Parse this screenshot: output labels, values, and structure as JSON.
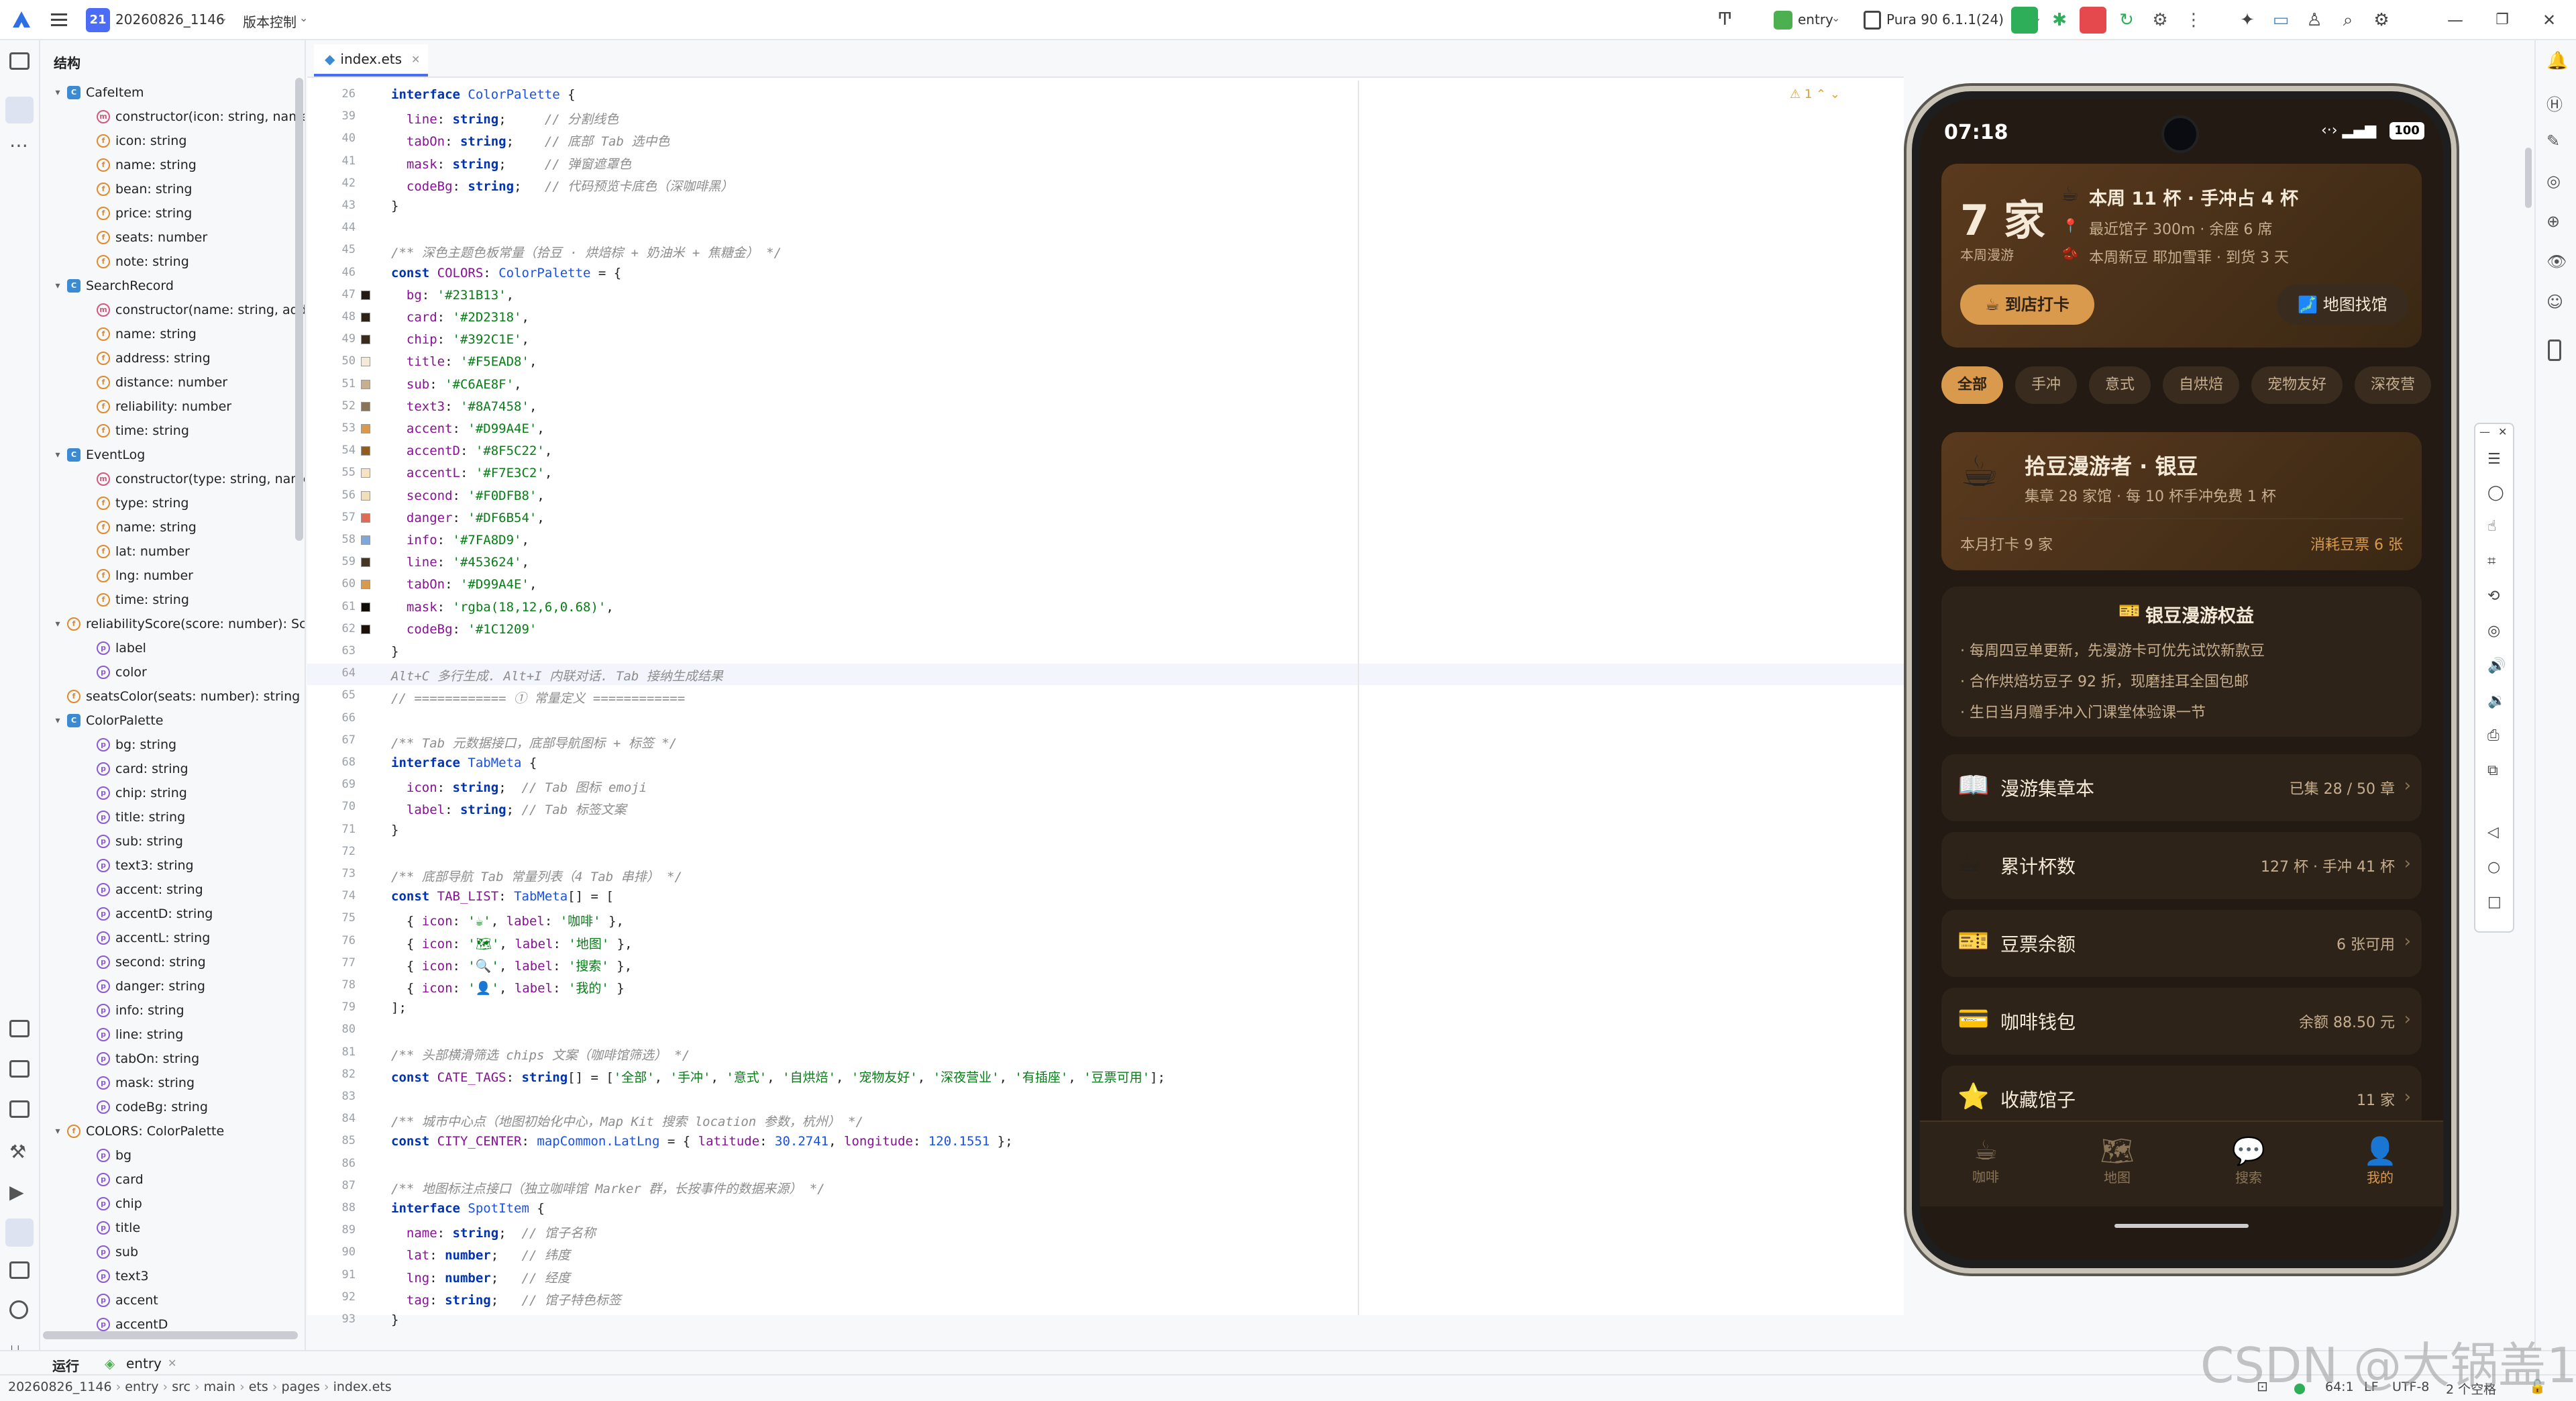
{
  "titlebar": {
    "project_badge": "21",
    "project": "20260826_1146",
    "vcs": "版本控制",
    "module": "entry",
    "device": "Pura 90 6.1.1(24)"
  },
  "structure": {
    "title": "结构",
    "items": [
      {
        "indent": 0,
        "icon": "c",
        "arrow": "▾",
        "text": "CafeItem"
      },
      {
        "indent": 1,
        "icon": "m",
        "arrow": "",
        "text": "constructor(icon: string, name:"
      },
      {
        "indent": 1,
        "icon": "f",
        "arrow": "",
        "text": "icon: string"
      },
      {
        "indent": 1,
        "icon": "f",
        "arrow": "",
        "text": "name: string"
      },
      {
        "indent": 1,
        "icon": "f",
        "arrow": "",
        "text": "bean: string"
      },
      {
        "indent": 1,
        "icon": "f",
        "arrow": "",
        "text": "price: string"
      },
      {
        "indent": 1,
        "icon": "f",
        "arrow": "",
        "text": "seats: number"
      },
      {
        "indent": 1,
        "icon": "f",
        "arrow": "",
        "text": "note: string"
      },
      {
        "indent": 0,
        "icon": "c",
        "arrow": "▾",
        "text": "SearchRecord"
      },
      {
        "indent": 1,
        "icon": "m",
        "arrow": "",
        "text": "constructor(name: string, addre"
      },
      {
        "indent": 1,
        "icon": "f",
        "arrow": "",
        "text": "name: string"
      },
      {
        "indent": 1,
        "icon": "f",
        "arrow": "",
        "text": "address: string"
      },
      {
        "indent": 1,
        "icon": "f",
        "arrow": "",
        "text": "distance: number"
      },
      {
        "indent": 1,
        "icon": "f",
        "arrow": "",
        "text": "reliability: number"
      },
      {
        "indent": 1,
        "icon": "f",
        "arrow": "",
        "text": "time: string"
      },
      {
        "indent": 0,
        "icon": "c",
        "arrow": "▾",
        "text": "EventLog"
      },
      {
        "indent": 1,
        "icon": "m",
        "arrow": "",
        "text": "constructor(type: string, name:"
      },
      {
        "indent": 1,
        "icon": "f",
        "arrow": "",
        "text": "type: string"
      },
      {
        "indent": 1,
        "icon": "f",
        "arrow": "",
        "text": "name: string"
      },
      {
        "indent": 1,
        "icon": "f",
        "arrow": "",
        "text": "lat: number"
      },
      {
        "indent": 1,
        "icon": "f",
        "arrow": "",
        "text": "lng: number"
      },
      {
        "indent": 1,
        "icon": "f",
        "arrow": "",
        "text": "time: string"
      },
      {
        "indent": 0,
        "icon": "f",
        "arrow": "▾",
        "text": "reliabilityScore(score: number): Sc"
      },
      {
        "indent": 1,
        "icon": "p",
        "arrow": "",
        "text": "label"
      },
      {
        "indent": 1,
        "icon": "p",
        "arrow": "",
        "text": "color"
      },
      {
        "indent": 0,
        "icon": "f",
        "arrow": "",
        "text": "seatsColor(seats: number): string"
      },
      {
        "indent": 0,
        "icon": "c",
        "arrow": "▾",
        "text": "ColorPalette"
      },
      {
        "indent": 1,
        "icon": "p",
        "arrow": "",
        "text": "bg: string"
      },
      {
        "indent": 1,
        "icon": "p",
        "arrow": "",
        "text": "card: string"
      },
      {
        "indent": 1,
        "icon": "p",
        "arrow": "",
        "text": "chip: string"
      },
      {
        "indent": 1,
        "icon": "p",
        "arrow": "",
        "text": "title: string"
      },
      {
        "indent": 1,
        "icon": "p",
        "arrow": "",
        "text": "sub: string"
      },
      {
        "indent": 1,
        "icon": "p",
        "arrow": "",
        "text": "text3: string"
      },
      {
        "indent": 1,
        "icon": "p",
        "arrow": "",
        "text": "accent: string"
      },
      {
        "indent": 1,
        "icon": "p",
        "arrow": "",
        "text": "accentD: string"
      },
      {
        "indent": 1,
        "icon": "p",
        "arrow": "",
        "text": "accentL: string"
      },
      {
        "indent": 1,
        "icon": "p",
        "arrow": "",
        "text": "second: string"
      },
      {
        "indent": 1,
        "icon": "p",
        "arrow": "",
        "text": "danger: string"
      },
      {
        "indent": 1,
        "icon": "p",
        "arrow": "",
        "text": "info: string"
      },
      {
        "indent": 1,
        "icon": "p",
        "arrow": "",
        "text": "line: string"
      },
      {
        "indent": 1,
        "icon": "p",
        "arrow": "",
        "text": "tabOn: string"
      },
      {
        "indent": 1,
        "icon": "p",
        "arrow": "",
        "text": "mask: string"
      },
      {
        "indent": 1,
        "icon": "p",
        "arrow": "",
        "text": "codeBg: string"
      },
      {
        "indent": 0,
        "icon": "f",
        "arrow": "▾",
        "text": "COLORS: ColorPalette"
      },
      {
        "indent": 1,
        "icon": "p",
        "arrow": "",
        "text": "bg"
      },
      {
        "indent": 1,
        "icon": "p",
        "arrow": "",
        "text": "card"
      },
      {
        "indent": 1,
        "icon": "p",
        "arrow": "",
        "text": "chip"
      },
      {
        "indent": 1,
        "icon": "p",
        "arrow": "",
        "text": "title"
      },
      {
        "indent": 1,
        "icon": "p",
        "arrow": "",
        "text": "sub"
      },
      {
        "indent": 1,
        "icon": "p",
        "arrow": "",
        "text": "text3"
      },
      {
        "indent": 1,
        "icon": "p",
        "arrow": "",
        "text": "accent"
      },
      {
        "indent": 1,
        "icon": "p",
        "arrow": "",
        "text": "accentD"
      }
    ]
  },
  "editor": {
    "tab": "index.ets",
    "warnings": "1",
    "lines": [
      {
        "n": "26",
        "html": "<span class='kw'>interface</span> <span class='ty'>ColorPalette</span> {"
      },
      {
        "n": "39",
        "html": "  <span class='pr'>line</span>: <span class='kw'>string</span>;     <span class='cm'>// 分割线色</span>"
      },
      {
        "n": "40",
        "html": "  <span class='pr'>tabOn</span>: <span class='kw'>string</span>;    <span class='cm'>// 底部 Tab 选中色</span>"
      },
      {
        "n": "41",
        "html": "  <span class='pr'>mask</span>: <span class='kw'>string</span>;     <span class='cm'>// 弹窗遮罩色</span>"
      },
      {
        "n": "42",
        "html": "  <span class='pr'>codeBg</span>: <span class='kw'>string</span>;   <span class='cm'>// 代码预览卡底色（深咖啡黑）</span>"
      },
      {
        "n": "43",
        "html": "}"
      },
      {
        "n": "44",
        "html": ""
      },
      {
        "n": "45",
        "html": "<span class='cm'>/** 深色主题色板常量（拾豆 · 烘焙棕 + 奶油米 + 焦糖金） */</span>"
      },
      {
        "n": "46",
        "html": "<span class='kw'>const</span> <span class='pr'>COLORS</span>: <span class='ty'>ColorPalette</span> = {"
      },
      {
        "n": "47",
        "sw": "#231B13",
        "html": "  <span class='pr'>bg</span>: <span class='str'>'#231B13'</span>,"
      },
      {
        "n": "48",
        "sw": "#2D2318",
        "html": "  <span class='pr'>card</span>: <span class='str'>'#2D2318'</span>,"
      },
      {
        "n": "49",
        "sw": "#392C1E",
        "html": "  <span class='pr'>chip</span>: <span class='str'>'#392C1E'</span>,"
      },
      {
        "n": "50",
        "sw": "#F5EAD8",
        "html": "  <span class='pr'>title</span>: <span class='str'>'#F5EAD8'</span>,"
      },
      {
        "n": "51",
        "sw": "#C6AE8F",
        "html": "  <span class='pr'>sub</span>: <span class='str'>'#C6AE8F'</span>,"
      },
      {
        "n": "52",
        "sw": "#8A7458",
        "html": "  <span class='pr'>text3</span>: <span class='str'>'#8A7458'</span>,"
      },
      {
        "n": "53",
        "sw": "#D99A4E",
        "html": "  <span class='pr'>accent</span>: <span class='str'>'#D99A4E'</span>,"
      },
      {
        "n": "54",
        "sw": "#8F5C22",
        "html": "  <span class='pr'>accentD</span>: <span class='str'>'#8F5C22'</span>,"
      },
      {
        "n": "55",
        "sw": "#F7E3C2",
        "html": "  <span class='pr'>accentL</span>: <span class='str'>'#F7E3C2'</span>,"
      },
      {
        "n": "56",
        "sw": "#F0DFB8",
        "html": "  <span class='pr'>second</span>: <span class='str'>'#F0DFB8'</span>,"
      },
      {
        "n": "57",
        "sw": "#DF6B54",
        "html": "  <span class='pr'>danger</span>: <span class='str'>'#DF6B54'</span>,"
      },
      {
        "n": "58",
        "sw": "#7FA8D9",
        "html": "  <span class='pr'>info</span>: <span class='str'>'#7FA8D9'</span>,"
      },
      {
        "n": "59",
        "sw": "#453624",
        "html": "  <span class='pr'>line</span>: <span class='str'>'#453624'</span>,"
      },
      {
        "n": "60",
        "sw": "#D99A4E",
        "html": "  <span class='pr'>tabOn</span>: <span class='str'>'#D99A4E'</span>,"
      },
      {
        "n": "61",
        "sw": "#120C06",
        "html": "  <span class='pr'>mask</span>: <span class='str'>'rgba(18,12,6,0.68)'</span>,"
      },
      {
        "n": "62",
        "sw": "#1C1209",
        "html": "  <span class='pr'>codeBg</span>: <span class='str'>'#1C1209'</span>"
      },
      {
        "n": "63",
        "html": "}"
      },
      {
        "n": "64",
        "html": "<span class='cm'>Alt+C 多行生成. Alt+I 内联对话. Tab 接纳生成结果</span>",
        "cur": true
      },
      {
        "n": "65",
        "html": "<span class='cm'>// ============ ① 常量定义 ============</span>"
      },
      {
        "n": "66",
        "html": ""
      },
      {
        "n": "67",
        "html": "<span class='cm'>/** Tab 元数据接口，底部导航图标 + 标签 */</span>"
      },
      {
        "n": "68",
        "html": "<span class='kw'>interface</span> <span class='ty'>TabMeta</span> {"
      },
      {
        "n": "69",
        "html": "  <span class='pr'>icon</span>: <span class='kw'>string</span>;  <span class='cm'>// Tab 图标 emoji</span>"
      },
      {
        "n": "70",
        "html": "  <span class='pr'>label</span>: <span class='kw'>string</span>; <span class='cm'>// Tab 标签文案</span>"
      },
      {
        "n": "71",
        "html": "}"
      },
      {
        "n": "72",
        "html": ""
      },
      {
        "n": "73",
        "html": "<span class='cm'>/** 底部导航 Tab 常量列表（4 Tab 串排） */</span>"
      },
      {
        "n": "74",
        "html": "<span class='kw'>const</span> <span class='pr'>TAB_LIST</span>: <span class='ty'>TabMeta</span>[] = ["
      },
      {
        "n": "75",
        "html": "  { <span class='pr'>icon</span>: <span class='str'>'☕'</span>, <span class='pr'>label</span>: <span class='str'>'咖啡'</span> },"
      },
      {
        "n": "76",
        "html": "  { <span class='pr'>icon</span>: <span class='str'>'🗺'</span>, <span class='pr'>label</span>: <span class='str'>'地图'</span> },"
      },
      {
        "n": "77",
        "html": "  { <span class='pr'>icon</span>: <span class='str'>'🔍'</span>, <span class='pr'>label</span>: <span class='str'>'搜索'</span> },"
      },
      {
        "n": "78",
        "html": "  { <span class='pr'>icon</span>: <span class='str'>'👤'</span>, <span class='pr'>label</span>: <span class='str'>'我的'</span> }"
      },
      {
        "n": "79",
        "html": "];"
      },
      {
        "n": "80",
        "html": ""
      },
      {
        "n": "81",
        "html": "<span class='cm'>/** 头部横滑筛选 chips 文案（咖啡馆筛选） */</span>"
      },
      {
        "n": "82",
        "html": "<span class='kw'>const</span> <span class='pr'>CATE_TAGS</span>: <span class='kw'>string</span>[] = [<span class='str'>'全部'</span>, <span class='str'>'手冲'</span>, <span class='str'>'意式'</span>, <span class='str'>'自烘焙'</span>, <span class='str'>'宠物友好'</span>, <span class='str'>'深夜营业'</span>, <span class='str'>'有插座'</span>, <span class='str'>'豆票可用'</span>];"
      },
      {
        "n": "83",
        "html": ""
      },
      {
        "n": "84",
        "html": "<span class='cm'>/** 城市中心点（地图初始化中心，Map Kit 搜索 location 参数，杭州） */</span>"
      },
      {
        "n": "85",
        "html": "<span class='kw'>const</span> <span class='pr'>CITY_CENTER</span>: <span class='ty'>mapCommon.LatLng</span> = { <span class='pr'>latitude</span>: <span class='num'>30.2741</span>, <span class='pr'>longitude</span>: <span class='num'>120.1551</span> };"
      },
      {
        "n": "86",
        "html": ""
      },
      {
        "n": "87",
        "html": "<span class='cm'>/** 地图标注点接口（独立咖啡馆 Marker 群，长按事件的数据来源） */</span>"
      },
      {
        "n": "88",
        "html": "<span class='kw'>interface</span> <span class='ty'>SpotItem</span> {"
      },
      {
        "n": "89",
        "html": "  <span class='pr'>name</span>: <span class='kw'>string</span>;  <span class='cm'>// 馆子名称</span>"
      },
      {
        "n": "90",
        "html": "  <span class='pr'>lat</span>: <span class='kw'>number</span>;   <span class='cm'>// 纬度</span>"
      },
      {
        "n": "91",
        "html": "  <span class='pr'>lng</span>: <span class='kw'>number</span>;   <span class='cm'>// 经度</span>"
      },
      {
        "n": "92",
        "html": "  <span class='pr'>tag</span>: <span class='kw'>string</span>;   <span class='cm'>// 馆子特色标签</span>"
      },
      {
        "n": "93",
        "html": "}"
      }
    ]
  },
  "phone": {
    "time": "07:18",
    "battery": "100",
    "hero": {
      "count": "7 家",
      "count_sub": "本周漫游",
      "line1": "本周 11 杯 · 手冲占 4 杯",
      "line2": "最近馆子 300m · 余座 6 席",
      "line3": "本周新豆 耶加雪菲 · 到货 3 天",
      "checkin": "☕ 到店打卡",
      "map": "地图找馆"
    },
    "chips": [
      "全部",
      "手冲",
      "意式",
      "自烘焙",
      "宠物友好",
      "深夜营"
    ],
    "member": {
      "title": "拾豆漫游者 · 银豆",
      "sub": "集章 28 家馆 · 每 10 杯手冲免费 1 杯",
      "left": "本月打卡 9 家",
      "right": "消耗豆票 6 张"
    },
    "benefit": {
      "title": "银豆漫游权益",
      "items": [
        "每周四豆单更新，先漫游卡可优先试饮新款豆",
        "合作烘焙坊豆子 92 折，现磨挂耳全国包邮",
        "生日当月赠手冲入门课堂体验课一节"
      ]
    },
    "menu": [
      {
        "icon": "📖",
        "label": "漫游集章本",
        "value": "已集 28 / 50 章"
      },
      {
        "icon": "☕",
        "label": "累计杯数",
        "value": "127 杯 · 手冲 41 杯"
      },
      {
        "icon": "🎫",
        "label": "豆票余额",
        "value": "6 张可用"
      },
      {
        "icon": "💳",
        "label": "咖啡钱包",
        "value": "余额 88.50 元"
      },
      {
        "icon": "⭐",
        "label": "收藏馆子",
        "value": "11 家"
      }
    ],
    "nav": [
      {
        "icon": "☕",
        "label": "咖啡"
      },
      {
        "icon": "🗺",
        "label": "地图"
      },
      {
        "icon": "💬",
        "label": "搜索"
      },
      {
        "icon": "👤",
        "label": "我的"
      }
    ]
  },
  "bottom": {
    "run": "运行",
    "entry": "entry"
  },
  "status": {
    "path": [
      "20260826_1146",
      "entry",
      "src",
      "main",
      "ets",
      "pages",
      "index.ets"
    ],
    "pos": "64:1",
    "lf": "LF",
    "enc": "UTF-8",
    "indent": "2 个空格"
  },
  "watermark": "CSDN @大锅盖1"
}
